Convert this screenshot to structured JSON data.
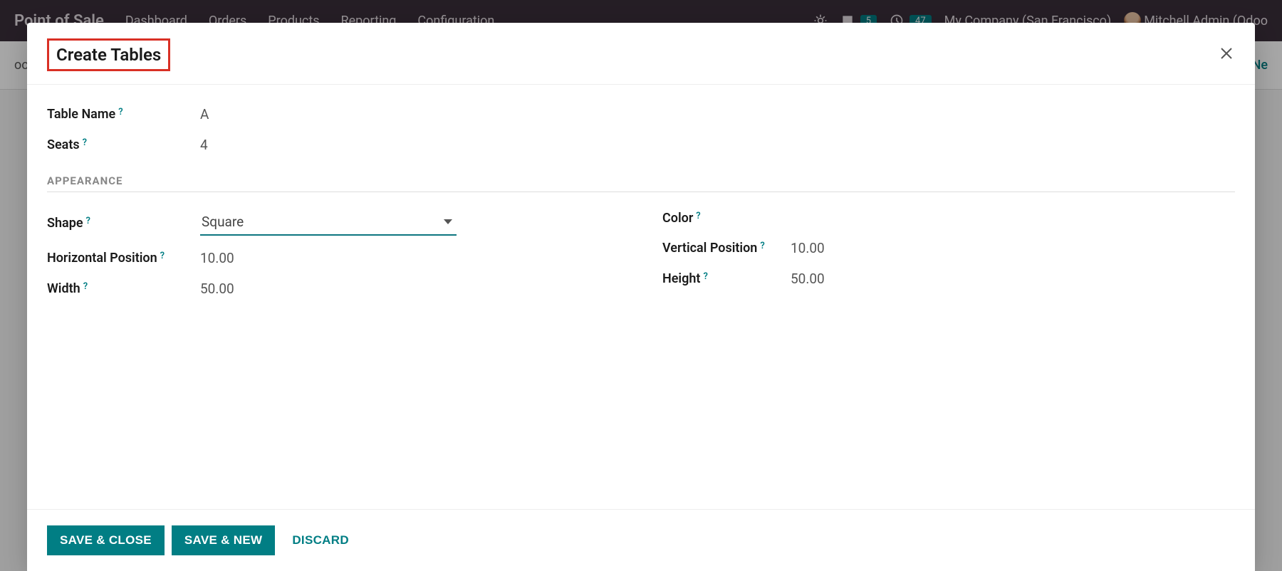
{
  "topbar": {
    "app_title": "Point of Sale",
    "nav": [
      "Dashboard",
      "Orders",
      "Products",
      "Reporting",
      "Configuration"
    ],
    "msg_badge": "5",
    "activity_badge": "47",
    "company": "My Company (San Francisco)",
    "user": "Mitchell Admin (Odoo"
  },
  "secondbar": {
    "left_hint": "oor",
    "right_link": "Ne"
  },
  "modal": {
    "title": "Create Tables",
    "fields": {
      "table_name_label": "Table Name",
      "table_name_value": "A",
      "seats_label": "Seats",
      "seats_value": "4"
    },
    "appearance_section": "APPEARANCE",
    "appearance": {
      "shape_label": "Shape",
      "shape_value": "Square",
      "color_label": "Color",
      "hpos_label": "Horizontal Position",
      "hpos_value": "10.00",
      "vpos_label": "Vertical Position",
      "vpos_value": "10.00",
      "width_label": "Width",
      "width_value": "50.00",
      "height_label": "Height",
      "height_value": "50.00"
    },
    "buttons": {
      "save_close": "SAVE & CLOSE",
      "save_new": "SAVE & NEW",
      "discard": "DISCARD"
    }
  }
}
